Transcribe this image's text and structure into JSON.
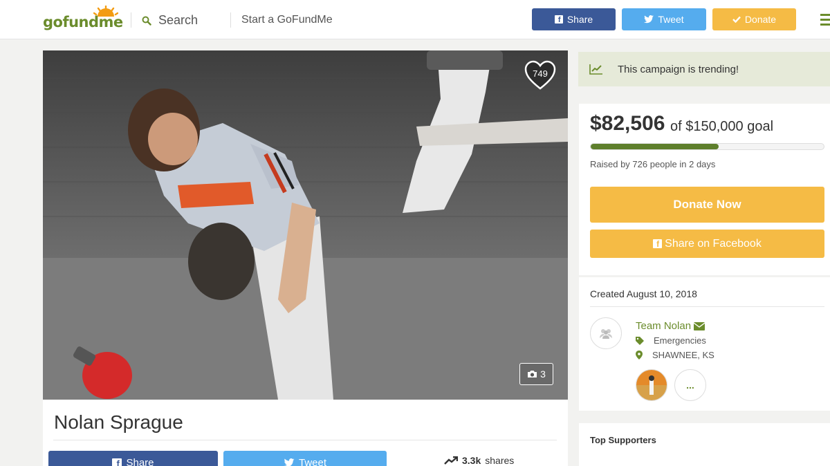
{
  "header": {
    "logo": "gofundme",
    "search_label": "Search",
    "start_link": "Start a GoFundMe",
    "share_label": "Share",
    "tweet_label": "Tweet",
    "donate_label": "Donate"
  },
  "campaign": {
    "hearts": "749",
    "photo_count": "3",
    "title": "Nolan Sprague",
    "share_label": "Share",
    "tweet_label": "Tweet",
    "shares_count": "3.3k",
    "shares_label": "shares"
  },
  "sidebar": {
    "trending_text": "This campaign is trending!",
    "raised_amount": "$82,506",
    "goal_text": "of $150,000 goal",
    "progress_fraction": 0.55,
    "raised_by": "Raised by 726 people in 2 days",
    "donate_now_label": "Donate Now",
    "share_facebook_label": "Share on Facebook",
    "created": "Created August 10, 2018",
    "organizer_name": "Team Nolan",
    "category": "Emergencies",
    "location": "SHAWNEE, KS",
    "more_label": "...",
    "top_supporters_title": "Top Supporters"
  },
  "colors": {
    "brand_green": "#6b8c2c",
    "facebook_blue": "#3b5998",
    "twitter_blue": "#55acee",
    "donate_orange": "#f5bb45",
    "progress_green": "#5e7f2c"
  },
  "icons": {
    "search": "search-icon",
    "facebook": "facebook-icon",
    "twitter": "twitter-icon",
    "check": "check-icon",
    "menu": "hamburger-menu-icon",
    "heart": "heart-icon",
    "camera": "camera-icon",
    "trending": "trending-chart-icon",
    "envelope": "envelope-icon",
    "tag": "tag-icon",
    "location": "location-pin-icon",
    "people": "people-icon"
  }
}
